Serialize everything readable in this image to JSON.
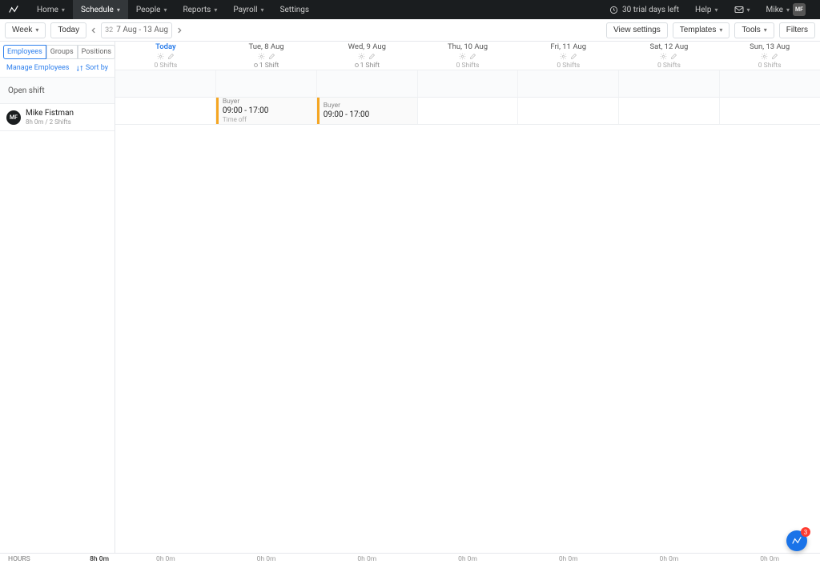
{
  "nav": {
    "items": [
      {
        "label": "Home"
      },
      {
        "label": "Schedule",
        "active": true
      },
      {
        "label": "People"
      },
      {
        "label": "Reports"
      },
      {
        "label": "Payroll"
      },
      {
        "label": "Settings",
        "noChev": true
      }
    ],
    "trial": "30 trial days left",
    "help": "Help",
    "user": "Mike",
    "initials": "MF"
  },
  "toolbar": {
    "period": "Week",
    "today": "Today",
    "weekNum": "32",
    "range": "7 Aug - 13 Aug",
    "viewSettings": "View settings",
    "templates": "Templates",
    "tools": "Tools",
    "filters": "Filters"
  },
  "sidebar": {
    "tabs": [
      "Employees",
      "Groups",
      "Positions"
    ],
    "manage": "Manage Employees",
    "sort": "Sort by",
    "openShift": "Open shift",
    "employee": {
      "name": "Mike Fistman",
      "sub": "8h 0m / 2 Shifts",
      "initials": "MF"
    }
  },
  "days": [
    {
      "label": "Today",
      "shifts": "0 Shifts",
      "today": true
    },
    {
      "label": "Tue, 8 Aug",
      "shifts": "1 Shift",
      "has": true,
      "dot": true
    },
    {
      "label": "Wed, 9 Aug",
      "shifts": "1 Shift",
      "has": true,
      "dot": true
    },
    {
      "label": "Thu, 10 Aug",
      "shifts": "0 Shifts"
    },
    {
      "label": "Fri, 11 Aug",
      "shifts": "0 Shifts"
    },
    {
      "label": "Sat, 12 Aug",
      "shifts": "0 Shifts"
    },
    {
      "label": "Sun, 13 Aug",
      "shifts": "0 Shifts"
    }
  ],
  "shifts": [
    {
      "day": 1,
      "title": "Buyer",
      "time": "09:00  - 17:00",
      "sub": "Time off"
    },
    {
      "day": 2,
      "title": "Buyer",
      "time": "09:00  - 17:00"
    }
  ],
  "footer": {
    "label": "HOURS",
    "total": "8h 0m",
    "cols": [
      "0h 0m",
      "0h 0m",
      "0h 0m",
      "0h 0m",
      "0h 0m",
      "0h 0m",
      "0h 0m"
    ]
  },
  "fab": {
    "badge": "3"
  }
}
